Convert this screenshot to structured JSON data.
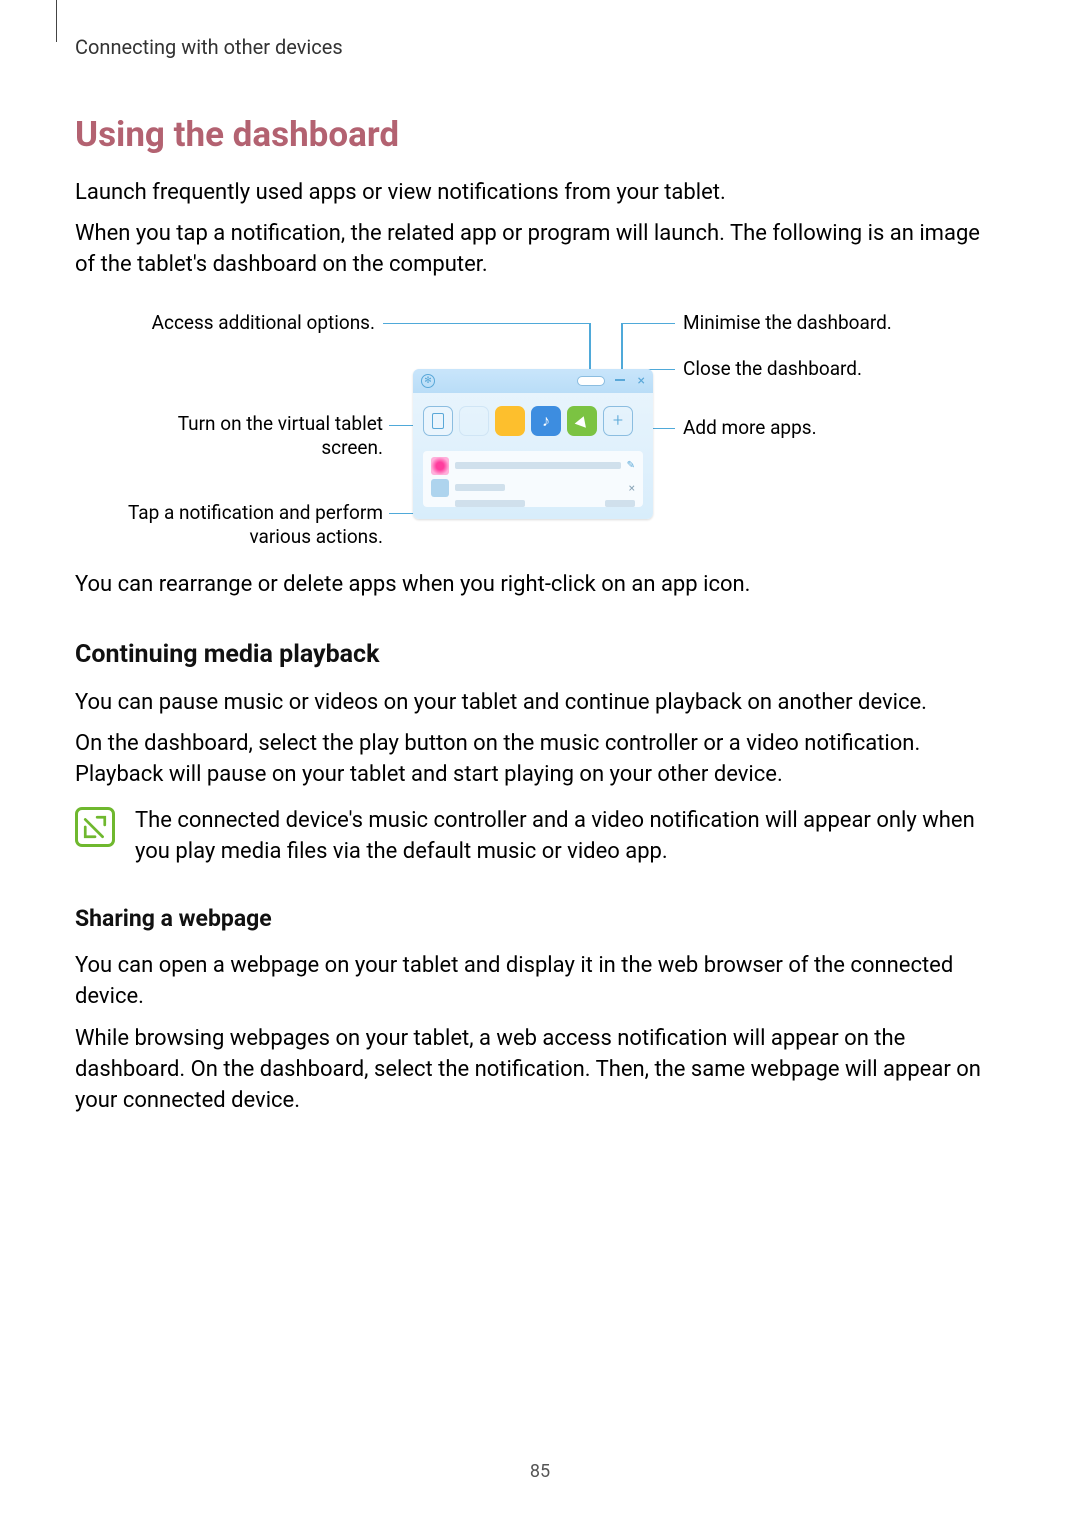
{
  "breadcrumb": "Connecting with other devices",
  "h1": "Using the dashboard",
  "intro1": "Launch frequently used apps or view notifications from your tablet.",
  "intro2": "When you tap a notification, the related app or program will launch. The following is an image of the tablet's dashboard on the computer.",
  "callouts": {
    "options": "Access additional options.",
    "virtual": "Turn on the virtual tablet screen.",
    "notif": "Tap a notification and perform various actions.",
    "minimise": "Minimise the dashboard.",
    "close": "Close the dashboard.",
    "addapps": "Add more apps."
  },
  "rearrange": "You can rearrange or delete apps when you right-click on an app icon.",
  "h2_media": "Continuing media playback",
  "media_p1": "You can pause music or videos on your tablet and continue playback on another device.",
  "media_p2": "On the dashboard, select the play button on the music controller or a video notification. Playback will pause on your tablet and start playing on your other device.",
  "note1": "The connected device's music controller and a video notification will appear only when you play media files via the default music or video app.",
  "h3_share": "Sharing a webpage",
  "share_p1": "You can open a webpage on your tablet and display it in the web browser of the connected device.",
  "share_p2": "While browsing webpages on your tablet, a web access notification will appear on the dashboard. On the dashboard, select the notification. Then, the same webpage will appear on your connected device.",
  "page_number": "85"
}
